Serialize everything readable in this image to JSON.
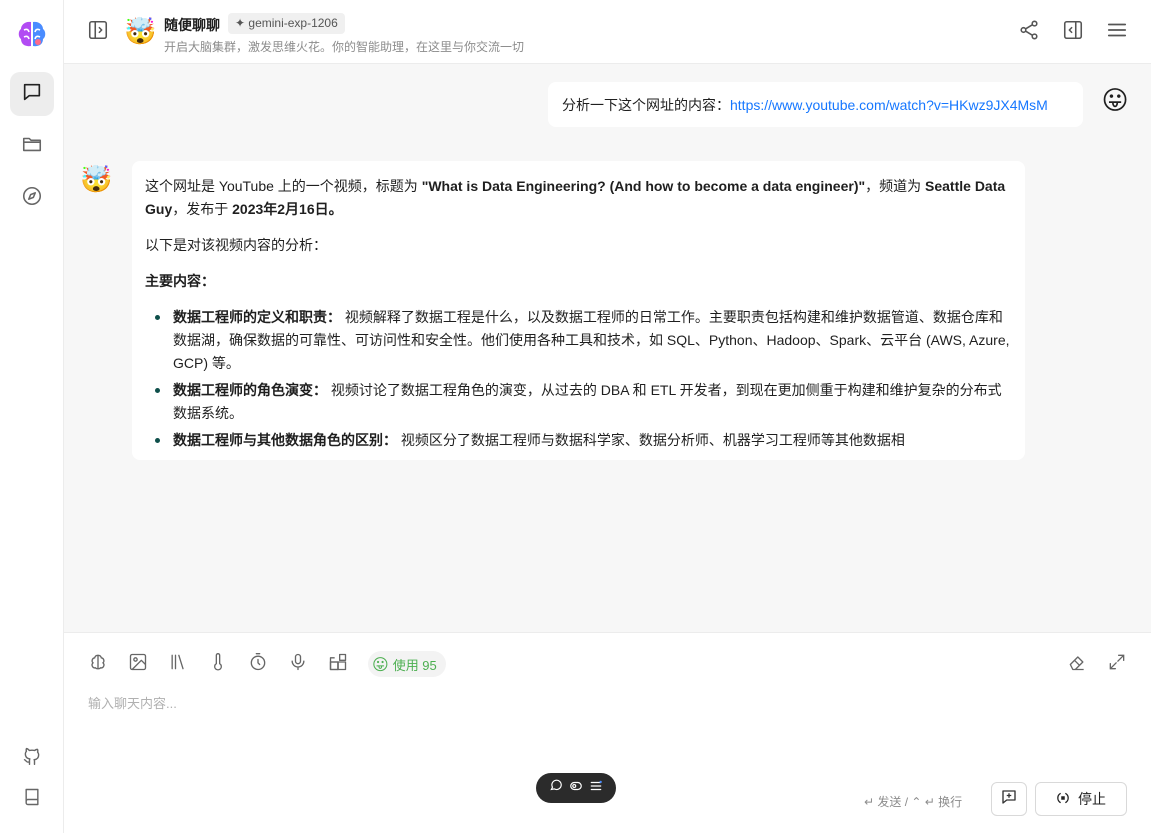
{
  "sidebar": {
    "logo": "brain-logo",
    "items": [
      {
        "name": "chat",
        "icon": "chat-bubble-icon",
        "active": true
      },
      {
        "name": "files",
        "icon": "folder-icon",
        "active": false
      },
      {
        "name": "discover",
        "icon": "compass-icon",
        "active": false
      }
    ],
    "bottom": [
      {
        "name": "github",
        "icon": "github-icon"
      },
      {
        "name": "docs",
        "icon": "book-icon"
      }
    ]
  },
  "header": {
    "title": "随便聊聊",
    "model": "✦ gemini-exp-1206",
    "subtitle": "开启大脑集群，激发思维火花。你的智能助理，在这里与你交流一切"
  },
  "messages": {
    "user": {
      "prefix": "分析一下这个网址的内容：",
      "link": "https://www.youtube.com/watch?v=HKwz9JX4MsM"
    },
    "assistant": {
      "p1_a": "这个网址是 YouTube 上的一个视频，标题为 ",
      "p1_title": "\"What is Data Engineering? (And how to become a data engineer)\"",
      "p1_b": "，频道为 ",
      "p1_channel": "Seattle Data Guy",
      "p1_c": "，发布于 ",
      "p1_date": "2023年2月16日。",
      "p2": "以下是对该视频内容的分析：",
      "p3": "主要内容：",
      "bullets": [
        {
          "title": "数据工程师的定义和职责：",
          "text": " 视频解释了数据工程是什么，以及数据工程师的日常工作。主要职责包括构建和维护数据管道、数据仓库和数据湖，确保数据的可靠性、可访问性和安全性。他们使用各种工具和技术，如 SQL、Python、Hadoop、Spark、云平台 (AWS, Azure, GCP) 等。"
        },
        {
          "title": "数据工程师的角色演变：",
          "text": " 视频讨论了数据工程角色的演变，从过去的 DBA 和 ETL 开发者，到现在更加侧重于构建和维护复杂的分布式数据系统。"
        },
        {
          "title": "数据工程师与其他数据角色的区别：",
          "text": " 视频区分了数据工程师与数据科学家、数据分析师、机器学习工程师等其他数据相"
        }
      ]
    }
  },
  "composer": {
    "usage": "使用 95",
    "placeholder": "输入聊天内容...",
    "hint": "↵ 发送 / ⌃ ↵ 换行",
    "stop_label": "停止"
  },
  "colors": {
    "accent": "#1677ff",
    "usage_green": "#4caf50",
    "bullet": "#0e4f4a"
  }
}
